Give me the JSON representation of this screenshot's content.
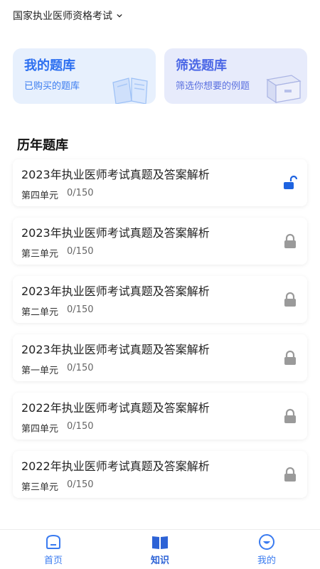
{
  "header": {
    "title": "国家执业医师资格考试",
    "chevron_icon": "chevron-down-icon"
  },
  "cards": [
    {
      "title": "我的题库",
      "subtitle": "已购买的题库",
      "icon": "book-illustration-icon"
    },
    {
      "title": "筛选题库",
      "subtitle": "筛选你想要的例题",
      "icon": "box-illustration-icon"
    }
  ],
  "section": {
    "title": "历年题库"
  },
  "items": [
    {
      "title": "2023年执业医师考试真题及答案解析",
      "unit": "第四单元",
      "progress": "0/150",
      "locked": false
    },
    {
      "title": "2023年执业医师考试真题及答案解析",
      "unit": "第三单元",
      "progress": "0/150",
      "locked": true
    },
    {
      "title": "2023年执业医师考试真题及答案解析",
      "unit": "第二单元",
      "progress": "0/150",
      "locked": true
    },
    {
      "title": "2023年执业医师考试真题及答案解析",
      "unit": "第一单元",
      "progress": "0/150",
      "locked": true
    },
    {
      "title": "2022年执业医师考试真题及答案解析",
      "unit": "第四单元",
      "progress": "0/150",
      "locked": true
    },
    {
      "title": "2022年执业医师考试真题及答案解析",
      "unit": "第三单元",
      "progress": "0/150",
      "locked": true
    }
  ],
  "tabbar": {
    "home": "首页",
    "knowledge": "知识",
    "me": "我的",
    "active": "knowledge"
  },
  "colors": {
    "accent": "#2c6ff0",
    "lock_open": "#1e63e0",
    "lock_closed": "#9a9a9a"
  }
}
